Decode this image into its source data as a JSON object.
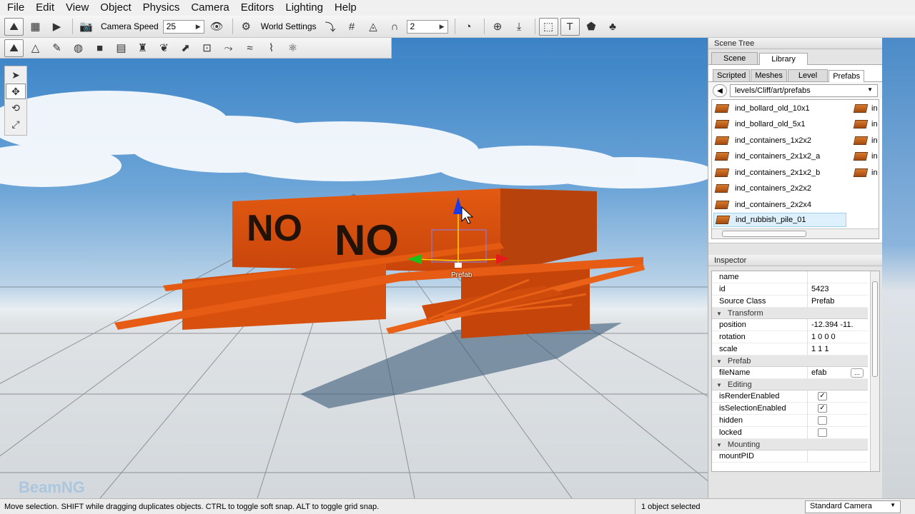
{
  "menu": [
    "File",
    "Edit",
    "View",
    "Object",
    "Physics",
    "Camera",
    "Editors",
    "Lighting",
    "Help"
  ],
  "toolbar": {
    "camera_speed_label": "Camera Speed",
    "camera_speed_value": "25",
    "world_settings_label": "World Settings",
    "snap_value": "2"
  },
  "viewport": {
    "gizmo_label": "Prefab",
    "watermark": "BeamNG",
    "sign_text": "NO"
  },
  "scene_tree": {
    "title": "Scene Tree",
    "tabs": [
      "Scene",
      "Library"
    ],
    "selected_tab": "Library",
    "subtabs": [
      "Scripted",
      "Meshes",
      "Level",
      "Prefabs"
    ],
    "selected_subtab": "Prefabs",
    "path": "levels/Cliff/art/prefabs",
    "files": [
      "ind_bollard_old_10x1",
      "ind_bollard_old_5x1",
      "ind_containers_1x2x2",
      "ind_containers_2x1x2_a",
      "ind_containers_2x1x2_b",
      "ind_containers_2x2x2",
      "ind_containers_2x2x4",
      "ind_rubbish_pile_01"
    ],
    "selected_file": "ind_rubbish_pile_01",
    "second_column": [
      "in",
      "in",
      "in",
      "in",
      "in"
    ]
  },
  "inspector": {
    "title": "Inspector",
    "rows": {
      "name": {
        "k": "name",
        "v": ""
      },
      "id": {
        "k": "id",
        "v": "5423"
      },
      "source_class": {
        "k": "Source Class",
        "v": "Prefab"
      },
      "position": {
        "k": "position",
        "v": "-12.394 -11."
      },
      "rotation": {
        "k": "rotation",
        "v": "1 0 0 0"
      },
      "scale": {
        "k": "scale",
        "v": "1 1 1"
      },
      "file_name": {
        "k": "fileName",
        "v": "efab"
      },
      "is_render_enabled": {
        "k": "isRenderEnabled",
        "v": true
      },
      "is_selection_enabled": {
        "k": "isSelectionEnabled",
        "v": true
      },
      "hidden": {
        "k": "hidden",
        "v": false
      },
      "locked": {
        "k": "locked",
        "v": false
      },
      "mount_pid": {
        "k": "mountPID",
        "v": ""
      }
    },
    "groups": {
      "transform": "Transform",
      "prefab": "Prefab",
      "editing": "Editing",
      "mounting": "Mounting"
    },
    "browse_label": "...",
    "check_mark": "✓"
  },
  "status": {
    "message": "Move selection.  SHIFT while dragging duplicates objects.  CTRL to toggle soft snap.  ALT to toggle grid snap.",
    "selection": "1 object selected",
    "camera": "Standard Camera"
  },
  "icons": {
    "check": "✓",
    "back": "◀",
    "dropdown": "▼",
    "spin_arrow": "▶",
    "group_open": "▼"
  }
}
